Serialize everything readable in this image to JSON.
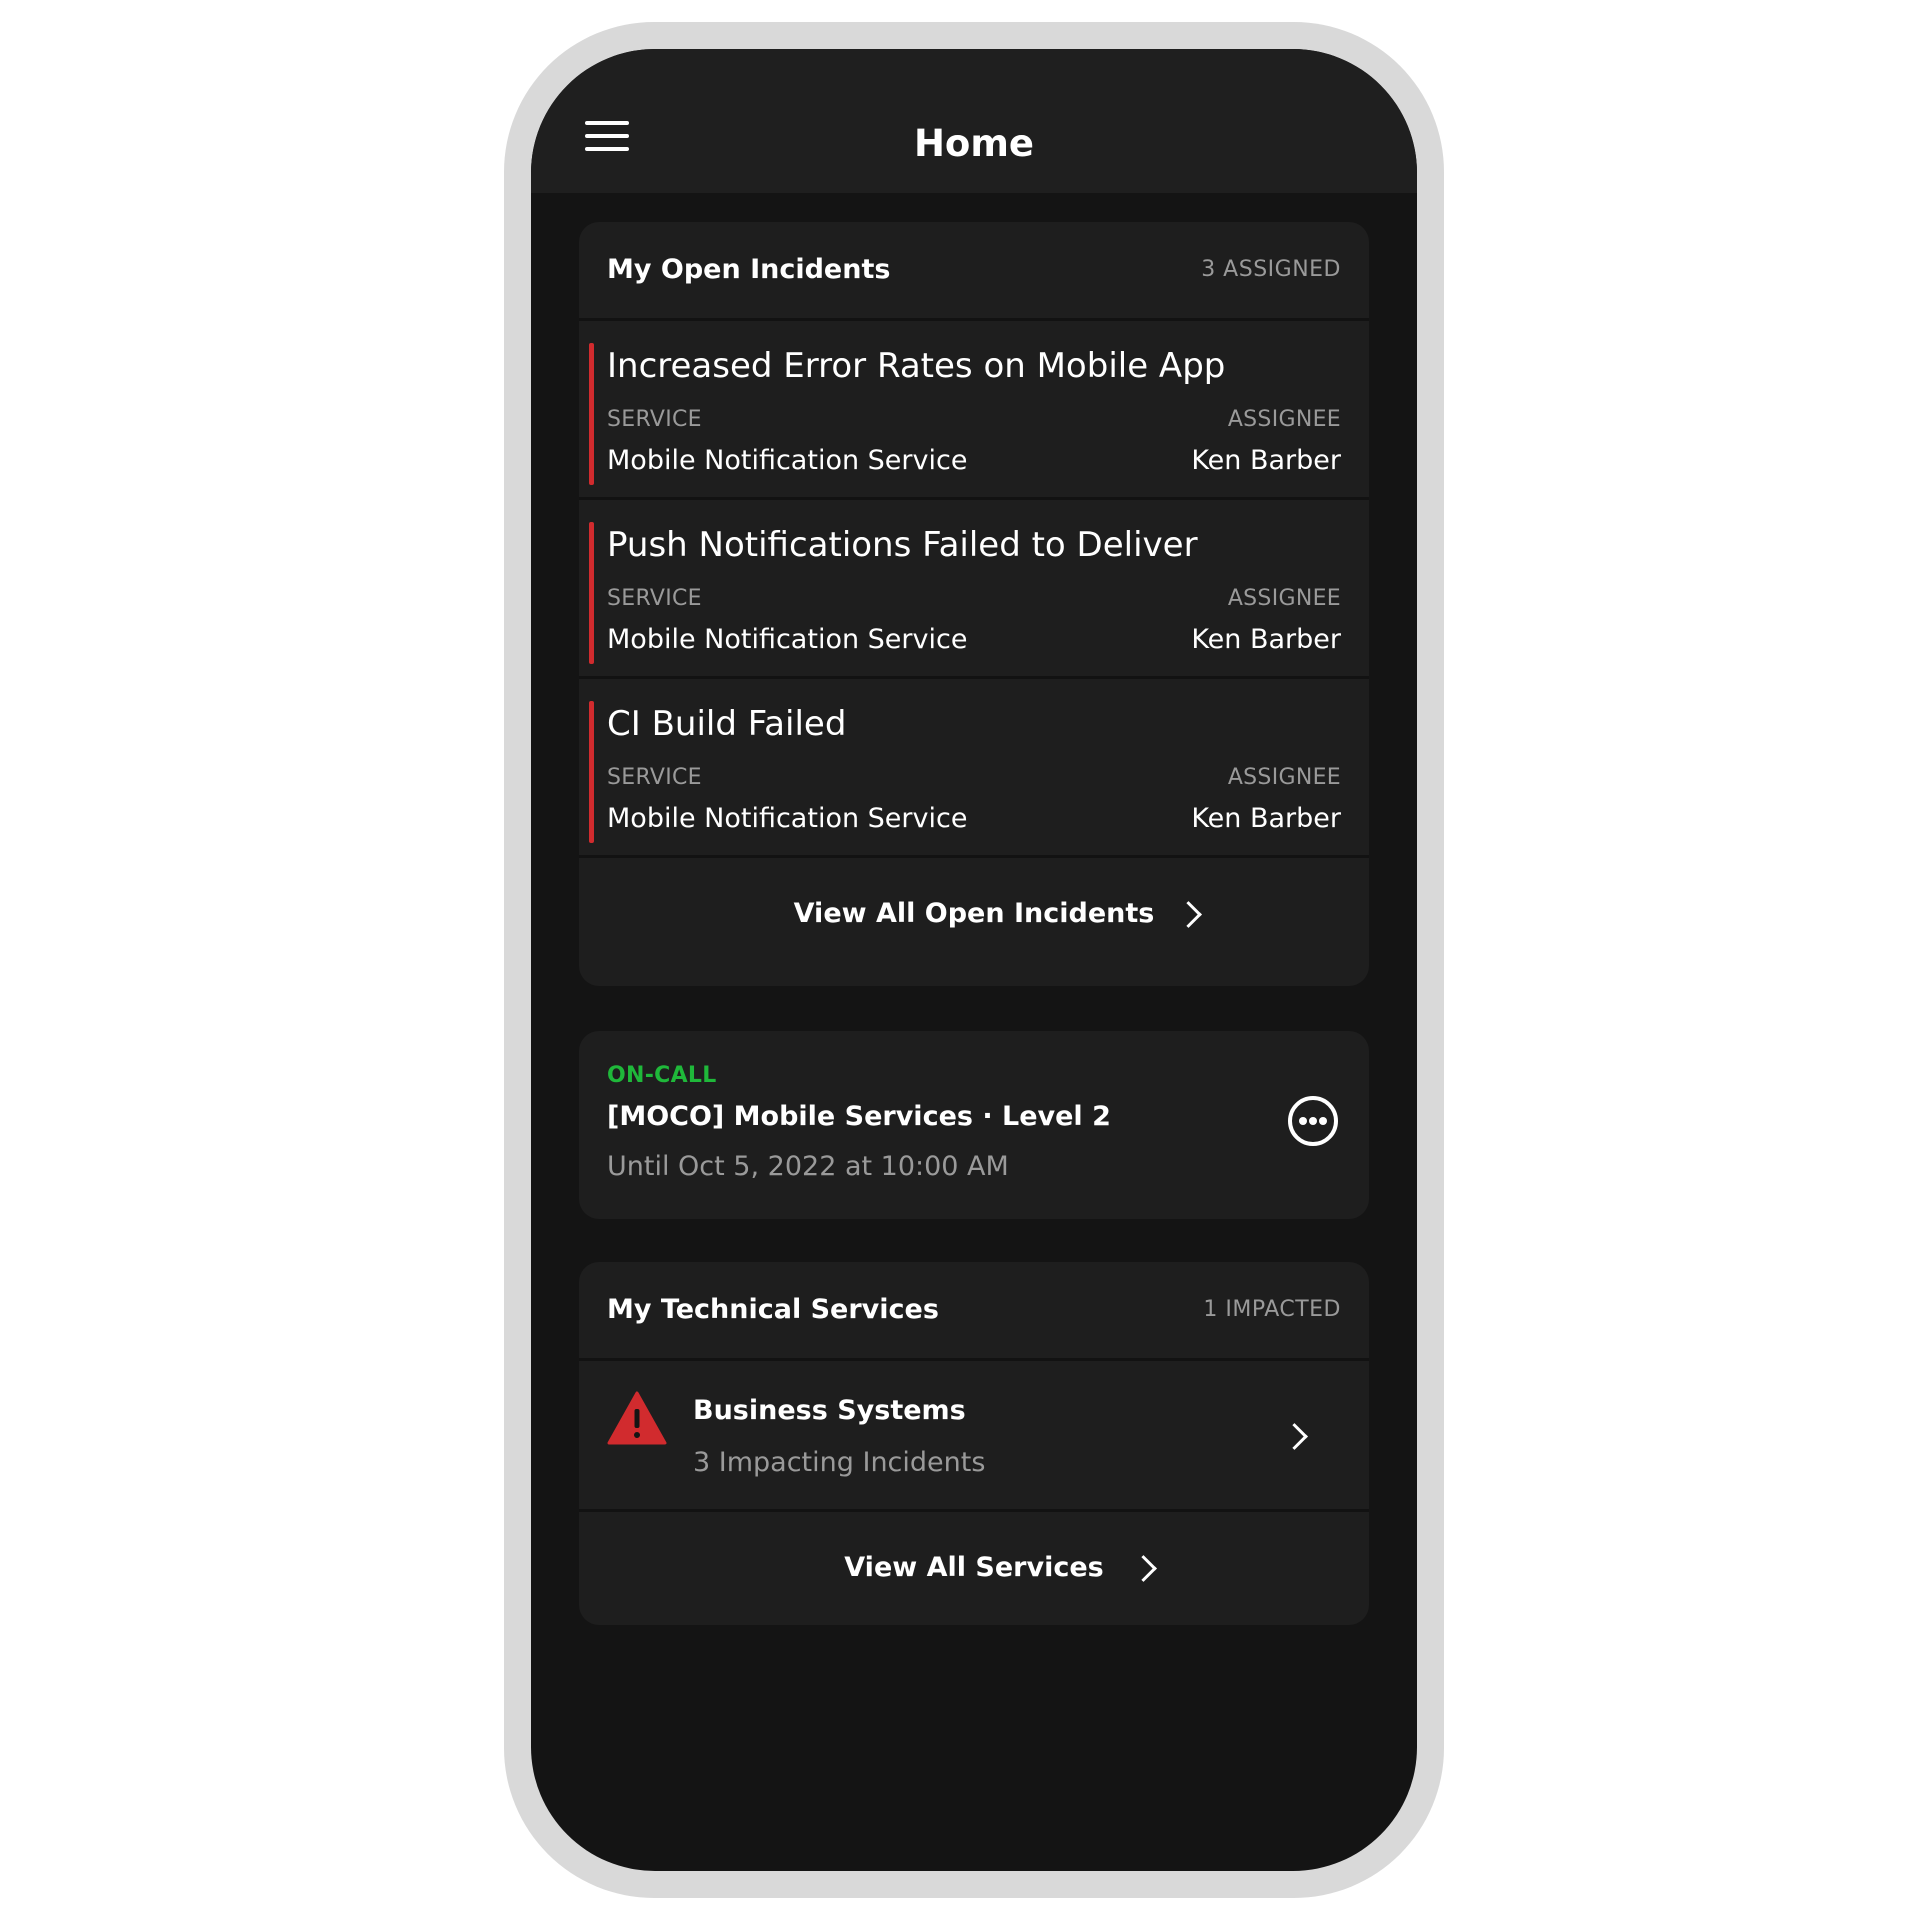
{
  "header": {
    "title": "Home",
    "menu_icon": "hamburger-menu-icon"
  },
  "open_incidents": {
    "title": "My Open Incidents",
    "count_label": "3 ASSIGNED",
    "items": [
      {
        "title": "Increased Error Rates on Mobile App",
        "service_label": "SERVICE",
        "service": "Mobile Notification Service",
        "assignee_label": "ASSIGNEE",
        "assignee": "Ken Barber"
      },
      {
        "title": "Push Notifications Failed to Deliver",
        "service_label": "SERVICE",
        "service": "Mobile Notification Service",
        "assignee_label": "ASSIGNEE",
        "assignee": "Ken Barber"
      },
      {
        "title": "CI Build Failed",
        "service_label": "SERVICE",
        "service": "Mobile Notification Service",
        "assignee_label": "ASSIGNEE",
        "assignee": "Ken Barber"
      }
    ],
    "view_all_label": "View All Open Incidents"
  },
  "on_call": {
    "label": "ON-CALL",
    "policy": "[MOCO] Mobile Services · Level 2",
    "until": "Until Oct 5, 2022 at 10:00 AM",
    "more_icon": "more-options-icon"
  },
  "technical_services": {
    "title": "My Technical Services",
    "count_label": "1 IMPACTED",
    "items": [
      {
        "name": "Business Systems",
        "subtitle": "3 Impacting Incidents",
        "icon": "warning-triangle-icon"
      }
    ],
    "view_all_label": "View All Services"
  },
  "colors": {
    "background": "#141414",
    "card": "#1e1e1e",
    "accent_red": "#d12b2e",
    "on_call_green": "#1fb83a",
    "frame": "#d9d9d9"
  }
}
